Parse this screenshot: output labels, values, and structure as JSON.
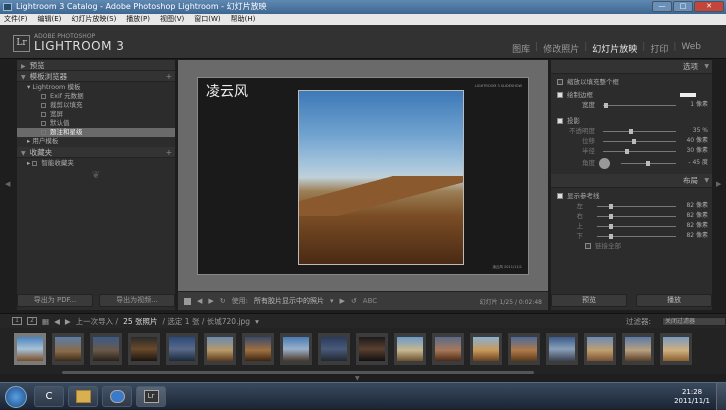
{
  "window": {
    "title": "Lightroom 3 Catalog - Adobe Photoshop Lightroom - 幻灯片放映",
    "minimize": "—",
    "maximize": "□",
    "close": "✕"
  },
  "menu": [
    "文件(F)",
    "编辑(E)",
    "幻灯片放映(S)",
    "播放(P)",
    "视图(V)",
    "窗口(W)",
    "帮助(H)"
  ],
  "brand": {
    "logo": "Lr",
    "top": "ADOBE PHOTOSHOP",
    "main": "LIGHTROOM 3"
  },
  "modules": [
    {
      "label": "图库",
      "sep": "|"
    },
    {
      "label": "修改照片",
      "sep": "|"
    },
    {
      "label": "幻灯片放映",
      "sep": "|"
    },
    {
      "label": "打印",
      "sep": "|"
    },
    {
      "label": "Web",
      "sep": ""
    }
  ],
  "left": {
    "preview": "预览",
    "template_browser": "模板浏览器",
    "plus": "+",
    "tree_root": "Lightroom 模板",
    "templates": [
      "Exif 元数据",
      "裁剪以填充",
      "宽屏",
      "默认值",
      "题注和星级"
    ],
    "user_templates": "用户模板",
    "collections": "收藏夹",
    "collection_item": "智能收藏夹",
    "export_pdf": "导出为 PDF...",
    "export_video": "导出为视频..."
  },
  "slide": {
    "title": "凌云风",
    "top_right": "LIGHTROOM 3 SLIDESHOW",
    "bottom_right": "凌云风 2011/11/1"
  },
  "toolbar": {
    "use_label": "使用:",
    "use_value": "所有胶片显示中的照片",
    "abc": "ABC",
    "count": "幻灯片 1/25 / 0:02:48"
  },
  "right": {
    "options": "选项",
    "zoom_fill": "缩放以填充整个框",
    "stroke_border": "绘制边框",
    "width": "宽度",
    "width_val": "1 像素",
    "cast_shadow": "投影",
    "opacity": "不透明度",
    "opacity_val": "35 %",
    "offset": "位移",
    "offset_val": "40 像素",
    "radius": "半径",
    "radius_val": "30 像素",
    "angle": "角度",
    "angle_val": "- 45 度",
    "layout": "布局",
    "show_guides": "显示参考线",
    "left_l": "左",
    "left_val": "82 像素",
    "right_l": "右",
    "right_val": "82 像素",
    "top_l": "上",
    "top_val": "82 像素",
    "bottom_l": "下",
    "bottom_val": "82 像素",
    "link_all": "链接全部",
    "preview_btn": "预览",
    "play_btn": "播放"
  },
  "filmstrip_bar": {
    "view1": "1",
    "view2": "2",
    "nav": "上一次导入 /",
    "count": "25 张照片",
    "selection": "/ 选定 1 张 / 长城720.jpg",
    "filter_label": "过滤器:",
    "filter_value": "关闭过滤器"
  },
  "taskbar": {
    "lr": "Lr",
    "time": "21:28",
    "date": "2011/11/1"
  }
}
